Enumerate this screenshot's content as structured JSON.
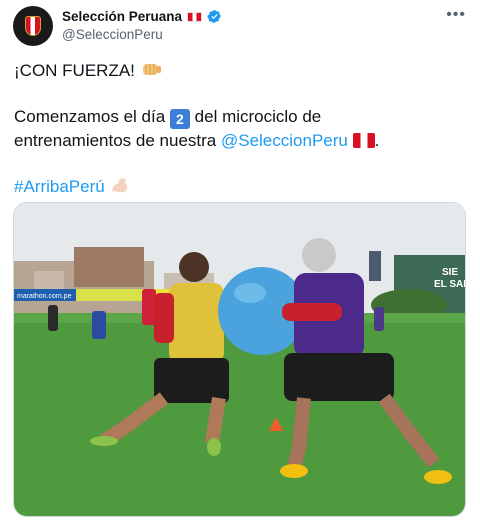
{
  "author": {
    "display_name": "Selección Peruana",
    "handle": "@SeleccionPeru",
    "avatar_icon": "peru-federation-crest-icon",
    "verified_icon": "verified-badge-icon",
    "flag_icon": "peru-flag-icon"
  },
  "menu": {
    "more_label": "•••"
  },
  "tweet": {
    "line1": "¡CON FUERZA!",
    "line1_emoji": "fist-bump-icon",
    "line2_a": "Comenzamos el día",
    "day_number": "2",
    "line2_b": "del microciclo de",
    "line3_a": "entrenamientos de nuestra",
    "mention": "@SeleccionPeru",
    "hashtag": "#ArribaPerú",
    "hashtag_emoji": "flexed-biceps-icon"
  },
  "media": {
    "description_icon": "training-photo-image",
    "signage_text": "SIE EL SAB",
    "banner_text": "marathon.com.pe"
  },
  "colors": {
    "link": "#1d9bf0",
    "verified": "#1d9bf0",
    "peru_red": "#d91023"
  }
}
